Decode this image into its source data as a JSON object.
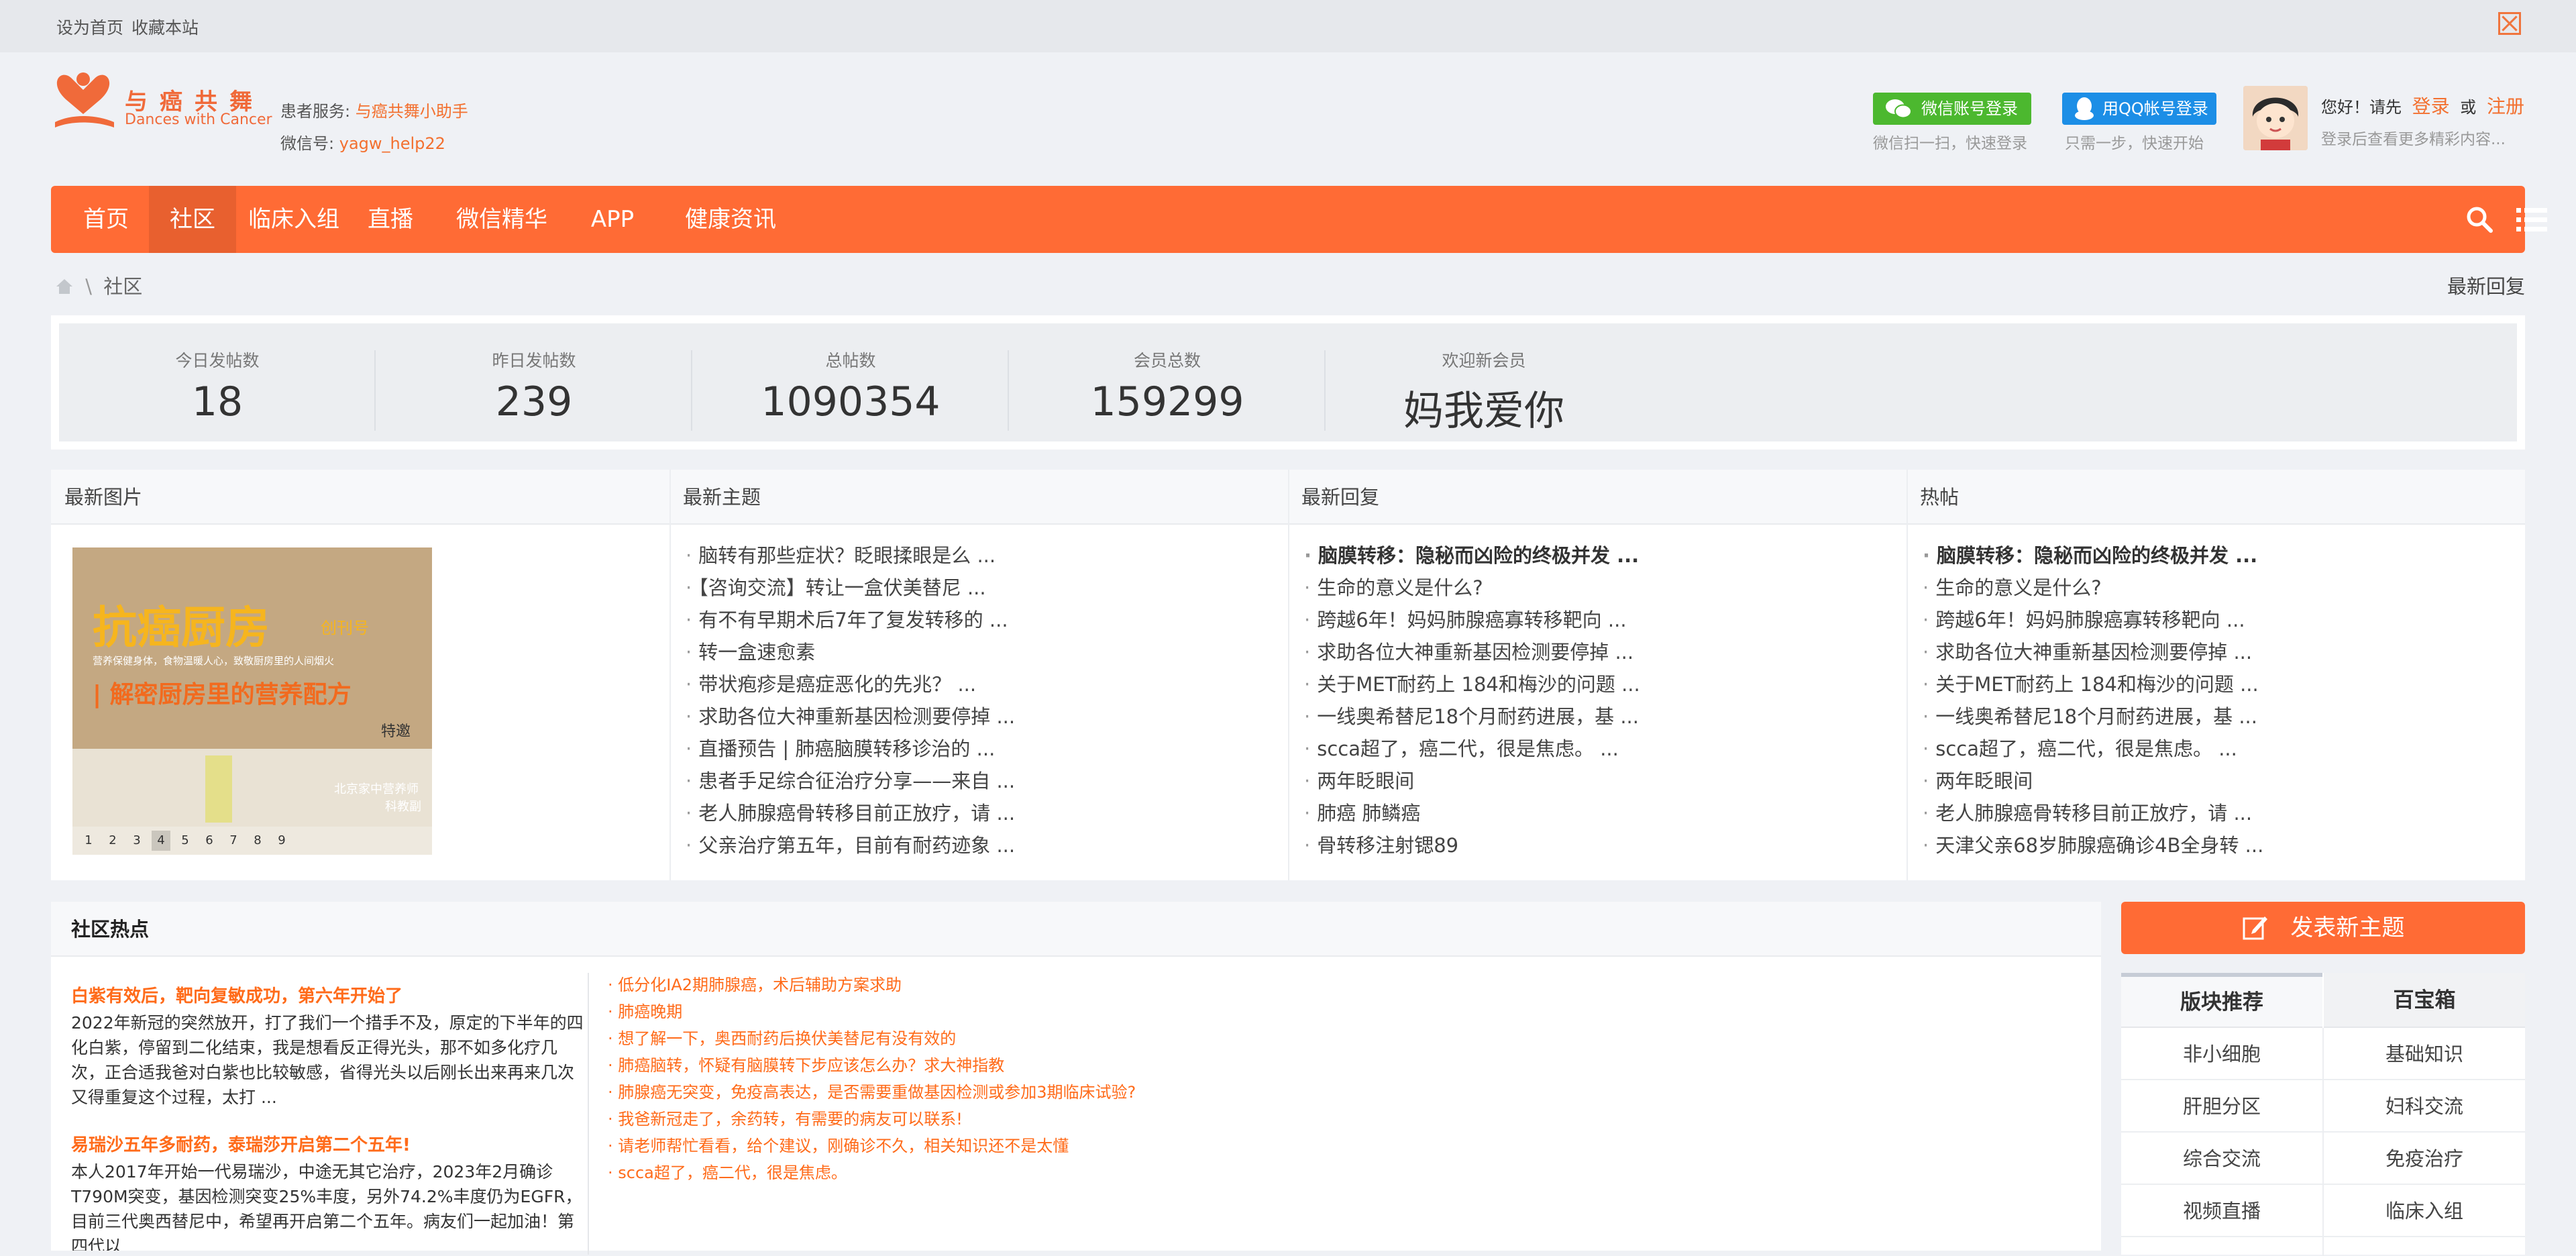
{
  "topbar": {
    "set_home": "设为首页",
    "bookmark": "收藏本站"
  },
  "header": {
    "logo_cn": "与癌共舞",
    "logo_en": "Dances with Cancer",
    "patient_service_label": "患者服务:",
    "patient_service_link": "与癌共舞小助手",
    "wechat_label": "微信号:",
    "wechat_id": "yagw_help22",
    "wx_login": "微信账号登录",
    "wx_hint": "微信扫一扫，快速登录",
    "qq_login": "用QQ帐号登录",
    "qq_hint": "只需一步，快速开始",
    "hello": "您好！请先",
    "login": "登录",
    "or": "或",
    "register": "注册",
    "login_tip": "登录后查看更多精彩内容..."
  },
  "nav": {
    "items": [
      "首页",
      "社区",
      "临床入组",
      "直播",
      "微信精华",
      "APP",
      "健康资讯"
    ],
    "active_index": 1
  },
  "breadcrumb": {
    "sep": "\\",
    "current": "社区",
    "latest_reply": "最新回复"
  },
  "stats": [
    {
      "label": "今日发帖数",
      "value": "18"
    },
    {
      "label": "昨日发帖数",
      "value": "239"
    },
    {
      "label": "总帖数",
      "value": "1090354"
    },
    {
      "label": "会员总数",
      "value": "159299"
    },
    {
      "label": "欢迎新会员",
      "value": "妈我爱你"
    }
  ],
  "panels": {
    "latest_images": {
      "title": "最新图片",
      "image_title": "抗癌厨房",
      "image_badge": "创刊号",
      "image_subtitle": "营养保健身体，食物温暖人心，致敬厨房里的人间烟火",
      "image_banner": "| 解密厨房里的营养配方",
      "image_side_text": "特邀",
      "image_bottom_text1": "北京家中营养师",
      "image_bottom_text2": "科教副",
      "pager": [
        "1",
        "2",
        "3",
        "4",
        "5",
        "6",
        "7",
        "8",
        "9"
      ],
      "pager_active": 3
    },
    "latest_topics": {
      "title": "最新主题",
      "items": [
        "脑转有那些症状？眨眼揉眼是么 ...",
        "【咨询交流】转让一盒伏美替尼 ...",
        "有不有早期术后7年了复发转移的 ...",
        "转一盒速愈素",
        "带状疱疹是癌症恶化的先兆？ ...",
        "求助各位大神重新基因检测要停掉 ...",
        "直播预告 | 肺癌脑膜转移诊治的 ...",
        "患者手足综合征治疗分享——来自 ...",
        "老人肺腺癌骨转移目前正放疗，请 ...",
        "父亲治疗第五年，目前有耐药迹象 ..."
      ]
    },
    "latest_replies": {
      "title": "最新回复",
      "items": [
        "脑膜转移：隐秘而凶险的终极并发 ...",
        "生命的意义是什么?",
        "跨越6年！妈妈肺腺癌寡转移靶向 ...",
        "求助各位大神重新基因检测要停掉 ...",
        "关于MET耐药上 184和梅沙的问题 ...",
        "一线奥希替尼18个月耐药进展，基 ...",
        "scca超了，癌二代，很是焦虑。 ...",
        "两年眨眼间",
        "肺癌 肺鳞癌",
        "骨转移注射锶89"
      ]
    },
    "hot_posts": {
      "title": "热帖",
      "items": [
        "脑膜转移：隐秘而凶险的终极并发 ...",
        "生命的意义是什么?",
        "跨越6年！妈妈肺腺癌寡转移靶向 ...",
        "求助各位大神重新基因检测要停掉 ...",
        "关于MET耐药上 184和梅沙的问题 ...",
        "一线奥希替尼18个月耐药进展，基 ...",
        "scca超了，癌二代，很是焦虑。 ...",
        "两年眨眼间",
        "老人肺腺癌骨转移目前正放疗，请 ...",
        "天津父亲68岁肺腺癌确诊4B全身转 ..."
      ]
    }
  },
  "community_hot": {
    "title": "社区热点",
    "stories": [
      {
        "title": "白紫有效后，靶向复敏成功，第六年开始了",
        "text": "2022年新冠的突然放开，打了我们一个措手不及，原定的下半年的四化白紫，停留到二化结束，我是想看反正得光头，那不如多化疗几次，正合适我爸对白紫也比较敏感，省得光头以后刚长出来再来几次又得重复这个过程，太打 ..."
      },
      {
        "title": "易瑞沙五年多耐药，泰瑞莎开启第二个五年!",
        "text": "本人2017年开始一代易瑞沙，中途无其它治疗，2023年2月确诊T790M突变，基因检测突变25%丰度，另外74.2%丰度仍为EGFR，目前三代奥西替尼中，希望再开启第二个五年。病友们一起加油！第四代以"
      }
    ],
    "links": [
      "低分化IA2期肺腺癌，术后辅助方案求助",
      "肺癌晚期",
      "想了解一下，奥西耐药后换伏美替尼有没有效的",
      "肺癌脑转，怀疑有脑膜转下步应该怎么办？求大神指教",
      "肺腺癌无突变，免疫高表达，是否需要重做基因检测或参加3期临床试验?",
      "我爸新冠走了，余药转，有需要的病友可以联系!",
      "请老师帮忙看看，给个建议，刚确诊不久，相关知识还不是太懂",
      "scca超了，癌二代，很是焦虑。"
    ]
  },
  "sidebar": {
    "post_button": "发表新主题",
    "tabs": [
      "版块推荐",
      "百宝箱"
    ],
    "left_items": [
      "非小细胞",
      "肝胆分区",
      "综合交流",
      "视频直播"
    ],
    "right_items": [
      "基础知识",
      "妇科交流",
      "免疫治疗",
      "临床入组"
    ]
  },
  "colors": {
    "brand": "#ff6b35",
    "wechat": "#4cb82f",
    "qq": "#1c8ee6",
    "hot": "#ff6b1a"
  }
}
